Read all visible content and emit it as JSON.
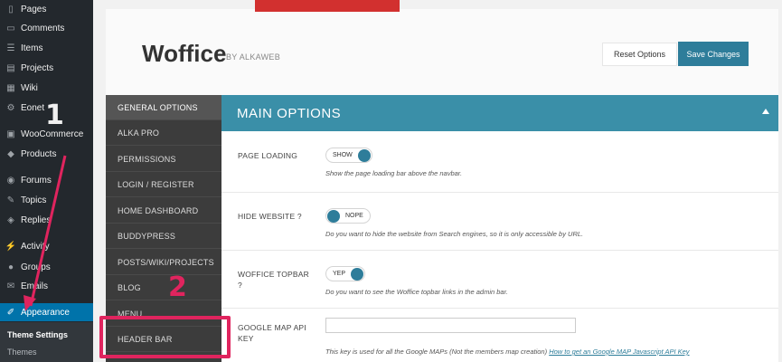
{
  "wp_menu": {
    "items": [
      {
        "label": "Pages",
        "icon": "pages-icon"
      },
      {
        "label": "Comments",
        "icon": "comments-icon"
      },
      {
        "label": "Items",
        "icon": "list-icon"
      },
      {
        "label": "Projects",
        "icon": "projects-icon"
      },
      {
        "label": "Wiki",
        "icon": "wiki-icon"
      },
      {
        "label": "Eonet",
        "icon": "eonet-icon"
      },
      {
        "label": "WooCommerce",
        "icon": "woocommerce-icon"
      },
      {
        "label": "Products",
        "icon": "products-icon"
      },
      {
        "label": "Forums",
        "icon": "forums-icon"
      },
      {
        "label": "Topics",
        "icon": "topics-icon"
      },
      {
        "label": "Replies",
        "icon": "replies-icon"
      },
      {
        "label": "Activity",
        "icon": "activity-icon"
      },
      {
        "label": "Groups",
        "icon": "groups-icon"
      },
      {
        "label": "Emails",
        "icon": "emails-icon"
      },
      {
        "label": "Appearance",
        "icon": "appearance-icon"
      }
    ],
    "submenu": [
      "Theme Settings",
      "Themes"
    ]
  },
  "header": {
    "brand": "Woffice",
    "byline": "BY ALKAWEB",
    "reset_label": "Reset Options",
    "save_label": "Save Changes"
  },
  "nav": {
    "items": [
      "GENERAL OPTIONS",
      "ALKA PRO",
      "PERMISSIONS",
      "LOGIN / REGISTER",
      "HOME DASHBOARD",
      "BUDDYPRESS",
      "POSTS/WIKI/PROJECTS",
      "BLOG",
      "MENU",
      "HEADER BAR"
    ]
  },
  "section": {
    "title": "MAIN OPTIONS",
    "rows": [
      {
        "label": "PAGE LOADING",
        "toggle": "SHOW",
        "desc": "Show the page loading bar above the navbar."
      },
      {
        "label": "HIDE WEBSITE ?",
        "toggle": "NOPE",
        "desc": "Do you want to hide the website from Search engines, so it is only accessible by URL."
      },
      {
        "label": "WOFFICE TOPBAR ?",
        "toggle": "YEP",
        "desc": "Do you want to see the Woffice topbar links in the admin bar."
      },
      {
        "label": "GOOGLE MAP API KEY",
        "input_value": "",
        "desc": "This key is used for all the Google MAPs (Not the members map creation)",
        "link": "How to get an Google MAP Javascript API Key"
      }
    ]
  },
  "annotations": {
    "one": "1",
    "two": "2"
  },
  "colors": {
    "accent": "#3a8fa8",
    "highlight": "#e0245e",
    "wp_active": "#0073aa"
  }
}
